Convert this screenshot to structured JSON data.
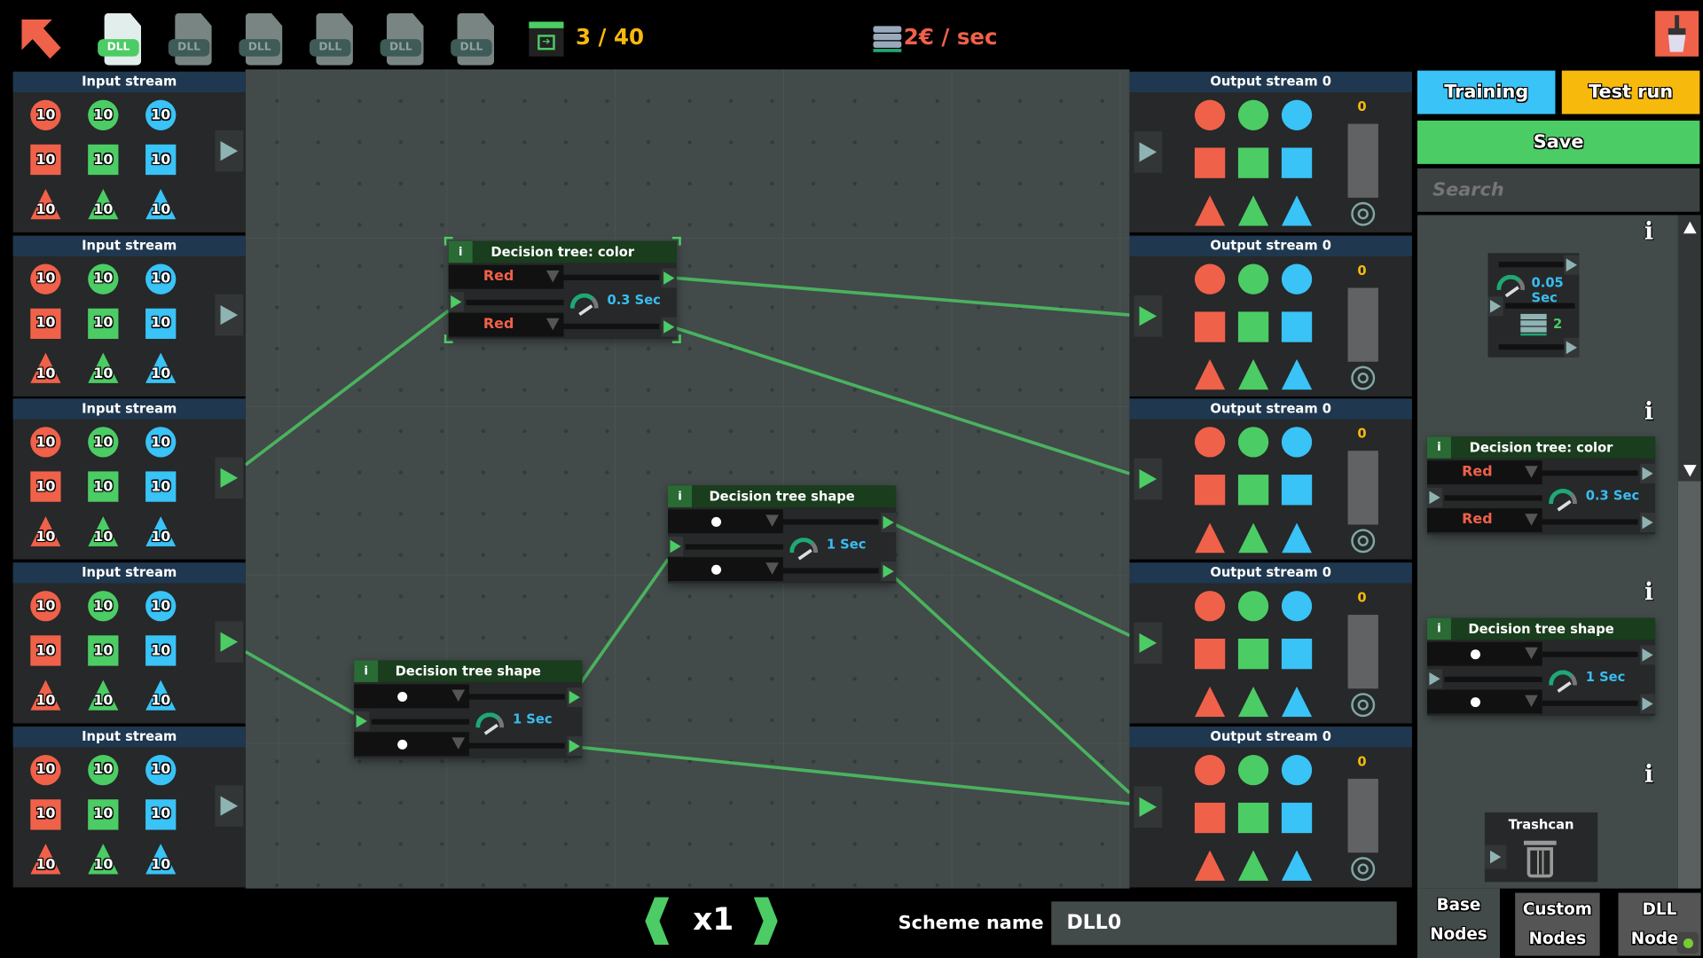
{
  "topbar": {
    "back_icon": "arrow-up-left-icon",
    "dll_tabs": [
      {
        "label": "DLL",
        "active": true
      },
      {
        "label": "DLL"
      },
      {
        "label": "DLL"
      },
      {
        "label": "DLL"
      },
      {
        "label": "DLL"
      },
      {
        "label": "DLL"
      }
    ],
    "level_progress": "3 / 40",
    "income": "2€ / sec",
    "clean_icon": "broom-icon"
  },
  "colors": {
    "red": "#f0614a",
    "green": "#4ccc64",
    "blue": "#39c3f7",
    "header": "#1f3850",
    "accent_yellow": "#f7b90c"
  },
  "input_streams": [
    {
      "title": "Input stream",
      "counts": [
        "10",
        "10",
        "10",
        "10",
        "10",
        "10",
        "10",
        "10",
        "10"
      ],
      "connected": false
    },
    {
      "title": "Input stream",
      "counts": [
        "10",
        "10",
        "10",
        "10",
        "10",
        "10",
        "10",
        "10",
        "10"
      ],
      "connected": false
    },
    {
      "title": "Input stream",
      "counts": [
        "10",
        "10",
        "10",
        "10",
        "10",
        "10",
        "10",
        "10",
        "10"
      ],
      "connected": true
    },
    {
      "title": "Input stream",
      "counts": [
        "10",
        "10",
        "10",
        "10",
        "10",
        "10",
        "10",
        "10",
        "10"
      ],
      "connected": true
    },
    {
      "title": "Input stream",
      "counts": [
        "10",
        "10",
        "10",
        "10",
        "10",
        "10",
        "10",
        "10",
        "10"
      ],
      "connected": false
    }
  ],
  "output_streams": [
    {
      "title": "Output stream 0",
      "count": "0",
      "connected": false
    },
    {
      "title": "Output stream 0",
      "count": "0",
      "connected": true
    },
    {
      "title": "Output stream 0",
      "count": "0",
      "connected": true
    },
    {
      "title": "Output stream 0",
      "count": "0",
      "connected": true
    },
    {
      "title": "Output stream 0",
      "count": "0",
      "connected": true
    }
  ],
  "canvas_nodes": [
    {
      "title": "Decision tree: color",
      "info": "i",
      "sel1": "Red",
      "sel2": "Red",
      "time": "0.3 Sec",
      "kind": "color",
      "selected": true
    },
    {
      "title": "Decision tree shape",
      "info": "i",
      "sel1": "",
      "sel2": "",
      "time": "1 Sec",
      "kind": "shape"
    },
    {
      "title": "Decision tree shape",
      "info": "i",
      "sel1": "",
      "sel2": "",
      "time": "1 Sec",
      "kind": "shape"
    }
  ],
  "right_panel": {
    "training": "Training",
    "test_run": "Test run",
    "save": "Save",
    "search_placeholder": "Search",
    "splitter": {
      "time": "0.05 Sec",
      "count": "2"
    },
    "palette": [
      {
        "title": "Decision tree: color",
        "info": "i",
        "sel1": "Red",
        "sel2": "Red",
        "time": "0.3 Sec",
        "kind": "color"
      },
      {
        "title": "Decision tree shape",
        "info": "i",
        "sel1": "",
        "sel2": "",
        "time": "1 Sec",
        "kind": "shape"
      }
    ],
    "info_label": "i",
    "trashcan": "Trashcan",
    "tabs": [
      {
        "line1": "Base",
        "line2": "Nodes",
        "active": true
      },
      {
        "line1": "Custom",
        "line2": "Nodes"
      },
      {
        "line1": "DLL",
        "line2": "Nodes"
      }
    ]
  },
  "bottombar": {
    "speed": "x1",
    "scheme_label": "Scheme name :",
    "scheme_name": "DLL0"
  }
}
